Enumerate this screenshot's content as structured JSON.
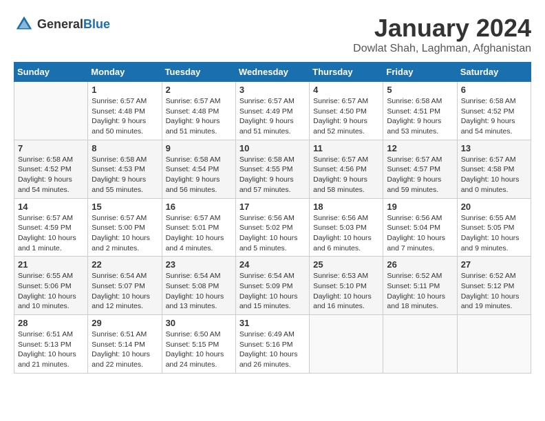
{
  "header": {
    "logo": {
      "text_general": "General",
      "text_blue": "Blue"
    },
    "month": "January 2024",
    "location": "Dowlat Shah, Laghman, Afghanistan"
  },
  "days_of_week": [
    "Sunday",
    "Monday",
    "Tuesday",
    "Wednesday",
    "Thursday",
    "Friday",
    "Saturday"
  ],
  "weeks": [
    [
      {
        "day": "",
        "info": ""
      },
      {
        "day": "1",
        "info": "Sunrise: 6:57 AM\nSunset: 4:48 PM\nDaylight: 9 hours\nand 50 minutes."
      },
      {
        "day": "2",
        "info": "Sunrise: 6:57 AM\nSunset: 4:48 PM\nDaylight: 9 hours\nand 51 minutes."
      },
      {
        "day": "3",
        "info": "Sunrise: 6:57 AM\nSunset: 4:49 PM\nDaylight: 9 hours\nand 51 minutes."
      },
      {
        "day": "4",
        "info": "Sunrise: 6:57 AM\nSunset: 4:50 PM\nDaylight: 9 hours\nand 52 minutes."
      },
      {
        "day": "5",
        "info": "Sunrise: 6:58 AM\nSunset: 4:51 PM\nDaylight: 9 hours\nand 53 minutes."
      },
      {
        "day": "6",
        "info": "Sunrise: 6:58 AM\nSunset: 4:52 PM\nDaylight: 9 hours\nand 54 minutes."
      }
    ],
    [
      {
        "day": "7",
        "info": "Sunrise: 6:58 AM\nSunset: 4:52 PM\nDaylight: 9 hours\nand 54 minutes."
      },
      {
        "day": "8",
        "info": "Sunrise: 6:58 AM\nSunset: 4:53 PM\nDaylight: 9 hours\nand 55 minutes."
      },
      {
        "day": "9",
        "info": "Sunrise: 6:58 AM\nSunset: 4:54 PM\nDaylight: 9 hours\nand 56 minutes."
      },
      {
        "day": "10",
        "info": "Sunrise: 6:58 AM\nSunset: 4:55 PM\nDaylight: 9 hours\nand 57 minutes."
      },
      {
        "day": "11",
        "info": "Sunrise: 6:57 AM\nSunset: 4:56 PM\nDaylight: 9 hours\nand 58 minutes."
      },
      {
        "day": "12",
        "info": "Sunrise: 6:57 AM\nSunset: 4:57 PM\nDaylight: 9 hours\nand 59 minutes."
      },
      {
        "day": "13",
        "info": "Sunrise: 6:57 AM\nSunset: 4:58 PM\nDaylight: 10 hours\nand 0 minutes."
      }
    ],
    [
      {
        "day": "14",
        "info": "Sunrise: 6:57 AM\nSunset: 4:59 PM\nDaylight: 10 hours\nand 1 minute."
      },
      {
        "day": "15",
        "info": "Sunrise: 6:57 AM\nSunset: 5:00 PM\nDaylight: 10 hours\nand 2 minutes."
      },
      {
        "day": "16",
        "info": "Sunrise: 6:57 AM\nSunset: 5:01 PM\nDaylight: 10 hours\nand 4 minutes."
      },
      {
        "day": "17",
        "info": "Sunrise: 6:56 AM\nSunset: 5:02 PM\nDaylight: 10 hours\nand 5 minutes."
      },
      {
        "day": "18",
        "info": "Sunrise: 6:56 AM\nSunset: 5:03 PM\nDaylight: 10 hours\nand 6 minutes."
      },
      {
        "day": "19",
        "info": "Sunrise: 6:56 AM\nSunset: 5:04 PM\nDaylight: 10 hours\nand 7 minutes."
      },
      {
        "day": "20",
        "info": "Sunrise: 6:55 AM\nSunset: 5:05 PM\nDaylight: 10 hours\nand 9 minutes."
      }
    ],
    [
      {
        "day": "21",
        "info": "Sunrise: 6:55 AM\nSunset: 5:06 PM\nDaylight: 10 hours\nand 10 minutes."
      },
      {
        "day": "22",
        "info": "Sunrise: 6:54 AM\nSunset: 5:07 PM\nDaylight: 10 hours\nand 12 minutes."
      },
      {
        "day": "23",
        "info": "Sunrise: 6:54 AM\nSunset: 5:08 PM\nDaylight: 10 hours\nand 13 minutes."
      },
      {
        "day": "24",
        "info": "Sunrise: 6:54 AM\nSunset: 5:09 PM\nDaylight: 10 hours\nand 15 minutes."
      },
      {
        "day": "25",
        "info": "Sunrise: 6:53 AM\nSunset: 5:10 PM\nDaylight: 10 hours\nand 16 minutes."
      },
      {
        "day": "26",
        "info": "Sunrise: 6:52 AM\nSunset: 5:11 PM\nDaylight: 10 hours\nand 18 minutes."
      },
      {
        "day": "27",
        "info": "Sunrise: 6:52 AM\nSunset: 5:12 PM\nDaylight: 10 hours\nand 19 minutes."
      }
    ],
    [
      {
        "day": "28",
        "info": "Sunrise: 6:51 AM\nSunset: 5:13 PM\nDaylight: 10 hours\nand 21 minutes."
      },
      {
        "day": "29",
        "info": "Sunrise: 6:51 AM\nSunset: 5:14 PM\nDaylight: 10 hours\nand 22 minutes."
      },
      {
        "day": "30",
        "info": "Sunrise: 6:50 AM\nSunset: 5:15 PM\nDaylight: 10 hours\nand 24 minutes."
      },
      {
        "day": "31",
        "info": "Sunrise: 6:49 AM\nSunset: 5:16 PM\nDaylight: 10 hours\nand 26 minutes."
      },
      {
        "day": "",
        "info": ""
      },
      {
        "day": "",
        "info": ""
      },
      {
        "day": "",
        "info": ""
      }
    ]
  ]
}
